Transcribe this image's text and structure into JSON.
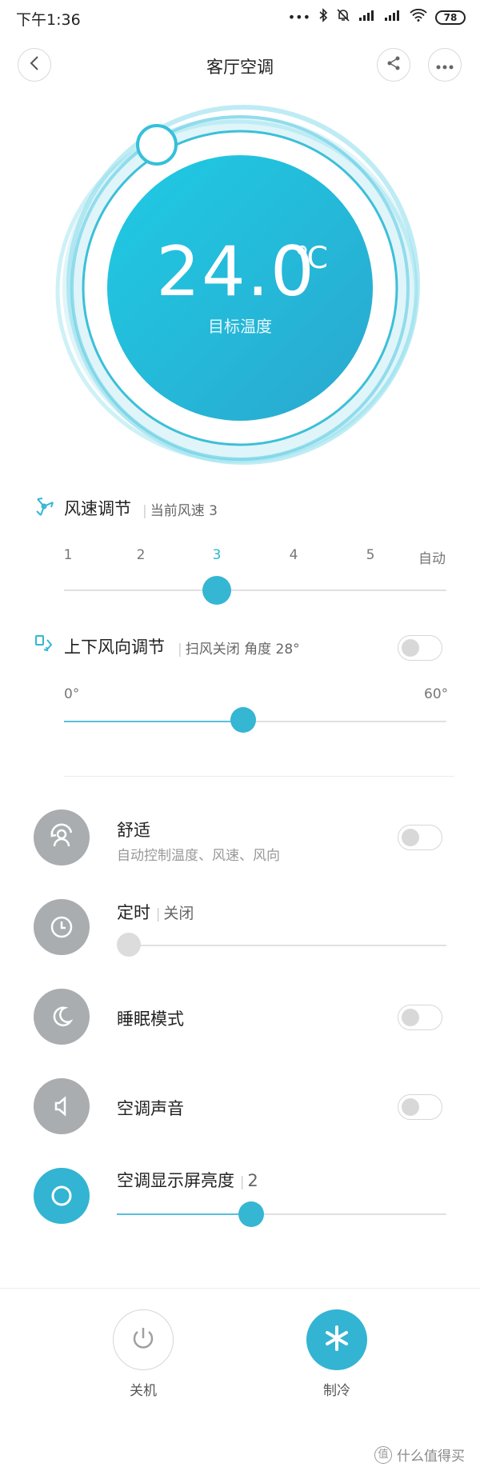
{
  "status_bar": {
    "time": "下午1:36",
    "battery": "78",
    "icons": [
      "more-dots-icon",
      "bluetooth-icon",
      "mute-bell-icon",
      "signal-icon",
      "signal-icon",
      "wifi-icon",
      "battery-icon"
    ]
  },
  "header": {
    "title": "客厅空调"
  },
  "dial": {
    "temperature": "24.0",
    "unit": "℃",
    "label": "目标温度",
    "accent": "#1ec3e0"
  },
  "fan_speed": {
    "title": "风速调节",
    "current_label": "当前风速 3",
    "ticks": [
      "1",
      "2",
      "3",
      "4",
      "5",
      "自动"
    ],
    "active_tick": "3",
    "value_index": 2
  },
  "vertical_swing": {
    "title": "上下风向调节",
    "status": "扫风关闭 角度 28°",
    "min": "0°",
    "max": "60°",
    "angle": 28,
    "range": [
      0,
      60
    ],
    "swing_on": false
  },
  "features": {
    "comfort": {
      "title": "舒适",
      "subtitle": "自动控制温度、风速、风向",
      "on": false
    },
    "timer": {
      "title": "定时",
      "status": "关闭",
      "level": 0
    },
    "sleep": {
      "title": "睡眠模式",
      "on": false
    },
    "sound": {
      "title": "空调声音",
      "on": false
    },
    "display": {
      "title": "空调显示屏亮度",
      "value": "2",
      "level_fraction": 0.4
    }
  },
  "bottom": {
    "power_label": "关机",
    "mode_label": "制冷"
  },
  "watermark": {
    "badge": "值",
    "text": "什么值得买"
  },
  "colors": {
    "accent": "#33b4d2",
    "inactive": "#a9adaf"
  }
}
